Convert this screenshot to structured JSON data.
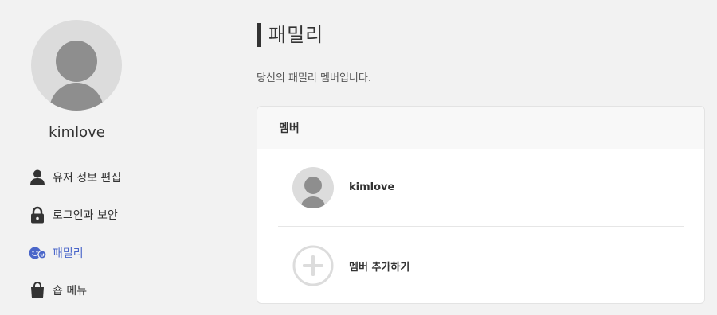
{
  "profile": {
    "username": "kimlove",
    "avatar_icon": "user-silhouette-icon"
  },
  "sidebar": {
    "items": [
      {
        "label": "유저 정보 편집",
        "icon": "user-icon",
        "active": false
      },
      {
        "label": "로그인과 보안",
        "icon": "lock-icon",
        "active": false
      },
      {
        "label": "패밀리",
        "icon": "family-icon",
        "active": true
      },
      {
        "label": "숍 메뉴",
        "icon": "shopping-bag-icon",
        "active": false
      }
    ],
    "active_color": "#4a66c9"
  },
  "main": {
    "title": "패밀리",
    "description": "당신의 패밀리 멤버입니다.",
    "card": {
      "header": "멤버",
      "members": [
        {
          "name": "kimlove",
          "icon": "user-silhouette-icon"
        }
      ],
      "add_label": "멤버 추가하기",
      "add_icon": "plus-circle-icon"
    }
  }
}
